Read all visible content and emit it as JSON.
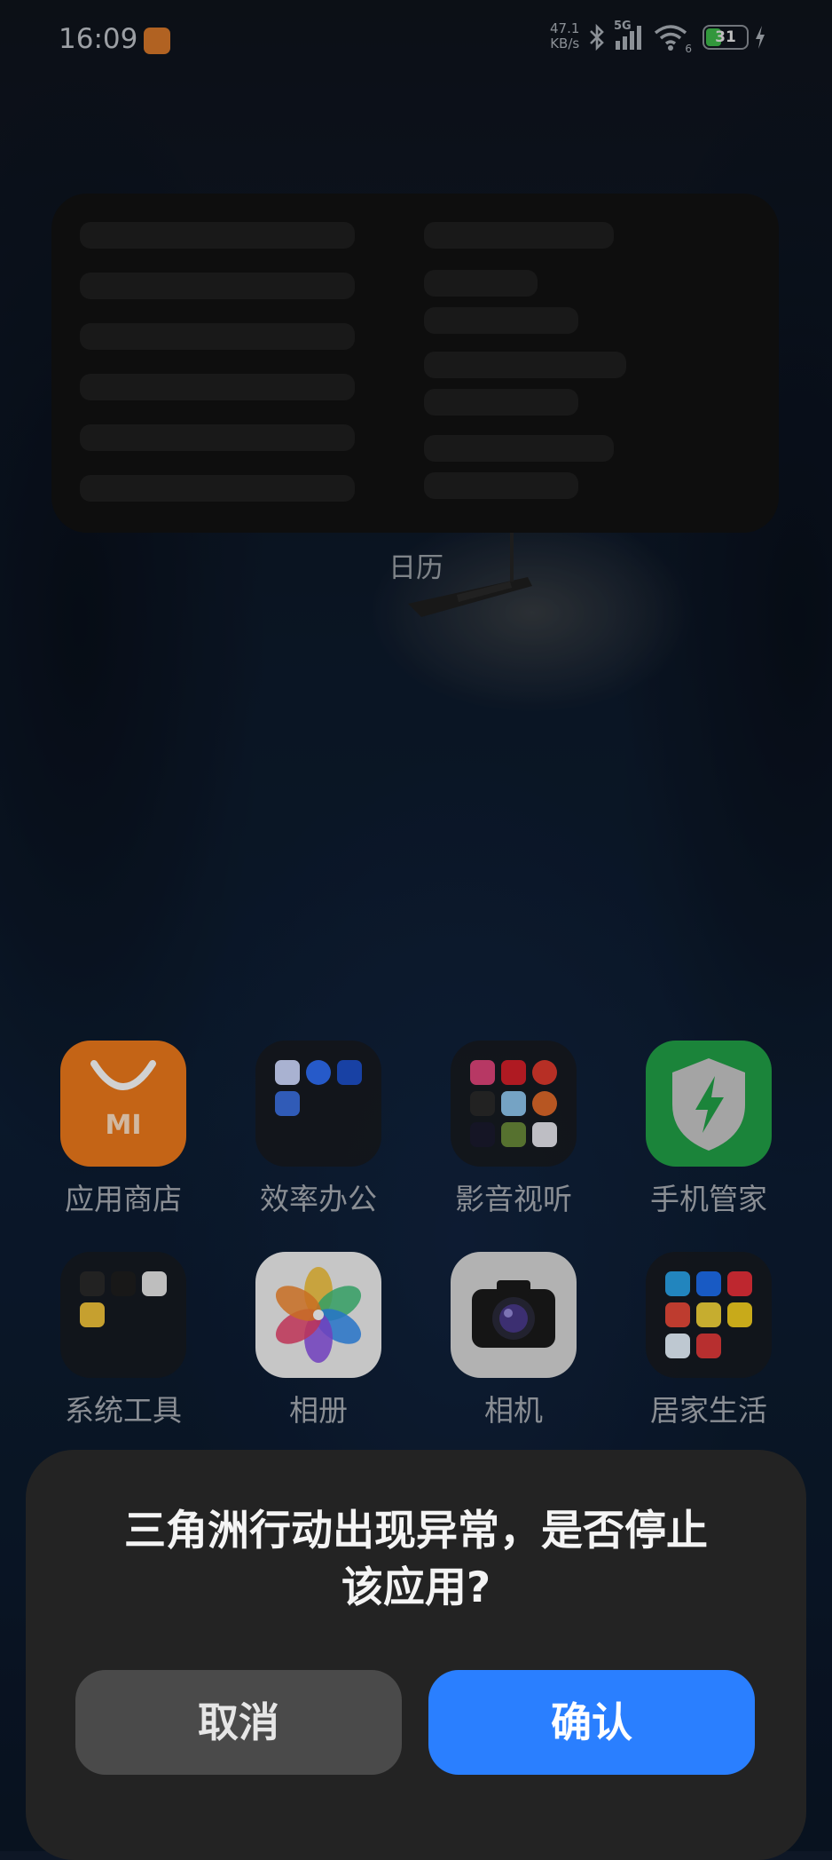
{
  "status_bar": {
    "time": "16:09",
    "net_speed_value": "47.1",
    "net_speed_unit": "KB/s",
    "signal_type": "5G",
    "wifi_badge": "6",
    "battery_level": "31",
    "icons": [
      "notification-app-icon",
      "bluetooth-icon",
      "cellular-signal-icon",
      "wifi-icon",
      "battery-icon",
      "charging-icon"
    ]
  },
  "widget": {
    "label": "日历"
  },
  "apps": [
    {
      "label": "应用商店",
      "icon": "mi-store-icon",
      "logo_text": "MI",
      "color": "#f07b1c"
    },
    {
      "label": "效率办公",
      "icon": "folder-icon"
    },
    {
      "label": "影音视听",
      "icon": "folder-icon"
    },
    {
      "label": "手机管家",
      "icon": "security-shield-icon",
      "color": "#22a247"
    },
    {
      "label": "系统工具",
      "icon": "folder-icon"
    },
    {
      "label": "相册",
      "icon": "gallery-icon"
    },
    {
      "label": "相机",
      "icon": "camera-icon"
    },
    {
      "label": "居家生活",
      "icon": "folder-icon"
    }
  ],
  "dialog": {
    "title_line1": "三角洲行动出现异常，是否停止",
    "title_line2": "该应用?",
    "cancel_label": "取消",
    "confirm_label": "确认",
    "confirm_color": "#2a7fff"
  }
}
